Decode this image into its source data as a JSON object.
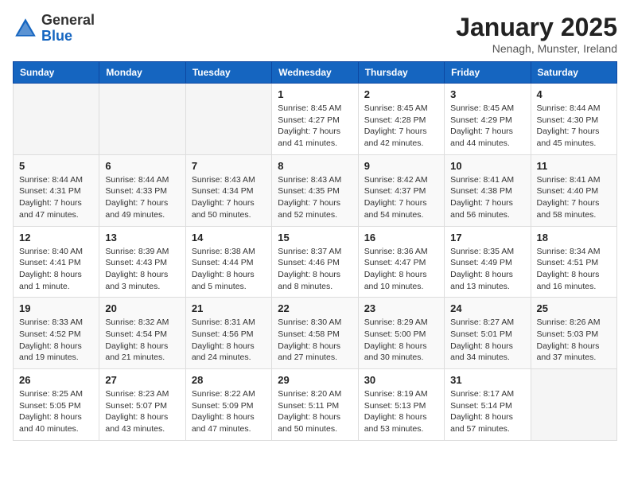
{
  "logo": {
    "general": "General",
    "blue": "Blue"
  },
  "header": {
    "title": "January 2025",
    "location": "Nenagh, Munster, Ireland"
  },
  "weekdays": [
    "Sunday",
    "Monday",
    "Tuesday",
    "Wednesday",
    "Thursday",
    "Friday",
    "Saturday"
  ],
  "weeks": [
    [
      {
        "day": "",
        "text": ""
      },
      {
        "day": "",
        "text": ""
      },
      {
        "day": "",
        "text": ""
      },
      {
        "day": "1",
        "text": "Sunrise: 8:45 AM\nSunset: 4:27 PM\nDaylight: 7 hours\nand 41 minutes."
      },
      {
        "day": "2",
        "text": "Sunrise: 8:45 AM\nSunset: 4:28 PM\nDaylight: 7 hours\nand 42 minutes."
      },
      {
        "day": "3",
        "text": "Sunrise: 8:45 AM\nSunset: 4:29 PM\nDaylight: 7 hours\nand 44 minutes."
      },
      {
        "day": "4",
        "text": "Sunrise: 8:44 AM\nSunset: 4:30 PM\nDaylight: 7 hours\nand 45 minutes."
      }
    ],
    [
      {
        "day": "5",
        "text": "Sunrise: 8:44 AM\nSunset: 4:31 PM\nDaylight: 7 hours\nand 47 minutes."
      },
      {
        "day": "6",
        "text": "Sunrise: 8:44 AM\nSunset: 4:33 PM\nDaylight: 7 hours\nand 49 minutes."
      },
      {
        "day": "7",
        "text": "Sunrise: 8:43 AM\nSunset: 4:34 PM\nDaylight: 7 hours\nand 50 minutes."
      },
      {
        "day": "8",
        "text": "Sunrise: 8:43 AM\nSunset: 4:35 PM\nDaylight: 7 hours\nand 52 minutes."
      },
      {
        "day": "9",
        "text": "Sunrise: 8:42 AM\nSunset: 4:37 PM\nDaylight: 7 hours\nand 54 minutes."
      },
      {
        "day": "10",
        "text": "Sunrise: 8:41 AM\nSunset: 4:38 PM\nDaylight: 7 hours\nand 56 minutes."
      },
      {
        "day": "11",
        "text": "Sunrise: 8:41 AM\nSunset: 4:40 PM\nDaylight: 7 hours\nand 58 minutes."
      }
    ],
    [
      {
        "day": "12",
        "text": "Sunrise: 8:40 AM\nSunset: 4:41 PM\nDaylight: 8 hours\nand 1 minute."
      },
      {
        "day": "13",
        "text": "Sunrise: 8:39 AM\nSunset: 4:43 PM\nDaylight: 8 hours\nand 3 minutes."
      },
      {
        "day": "14",
        "text": "Sunrise: 8:38 AM\nSunset: 4:44 PM\nDaylight: 8 hours\nand 5 minutes."
      },
      {
        "day": "15",
        "text": "Sunrise: 8:37 AM\nSunset: 4:46 PM\nDaylight: 8 hours\nand 8 minutes."
      },
      {
        "day": "16",
        "text": "Sunrise: 8:36 AM\nSunset: 4:47 PM\nDaylight: 8 hours\nand 10 minutes."
      },
      {
        "day": "17",
        "text": "Sunrise: 8:35 AM\nSunset: 4:49 PM\nDaylight: 8 hours\nand 13 minutes."
      },
      {
        "day": "18",
        "text": "Sunrise: 8:34 AM\nSunset: 4:51 PM\nDaylight: 8 hours\nand 16 minutes."
      }
    ],
    [
      {
        "day": "19",
        "text": "Sunrise: 8:33 AM\nSunset: 4:52 PM\nDaylight: 8 hours\nand 19 minutes."
      },
      {
        "day": "20",
        "text": "Sunrise: 8:32 AM\nSunset: 4:54 PM\nDaylight: 8 hours\nand 21 minutes."
      },
      {
        "day": "21",
        "text": "Sunrise: 8:31 AM\nSunset: 4:56 PM\nDaylight: 8 hours\nand 24 minutes."
      },
      {
        "day": "22",
        "text": "Sunrise: 8:30 AM\nSunset: 4:58 PM\nDaylight: 8 hours\nand 27 minutes."
      },
      {
        "day": "23",
        "text": "Sunrise: 8:29 AM\nSunset: 5:00 PM\nDaylight: 8 hours\nand 30 minutes."
      },
      {
        "day": "24",
        "text": "Sunrise: 8:27 AM\nSunset: 5:01 PM\nDaylight: 8 hours\nand 34 minutes."
      },
      {
        "day": "25",
        "text": "Sunrise: 8:26 AM\nSunset: 5:03 PM\nDaylight: 8 hours\nand 37 minutes."
      }
    ],
    [
      {
        "day": "26",
        "text": "Sunrise: 8:25 AM\nSunset: 5:05 PM\nDaylight: 8 hours\nand 40 minutes."
      },
      {
        "day": "27",
        "text": "Sunrise: 8:23 AM\nSunset: 5:07 PM\nDaylight: 8 hours\nand 43 minutes."
      },
      {
        "day": "28",
        "text": "Sunrise: 8:22 AM\nSunset: 5:09 PM\nDaylight: 8 hours\nand 47 minutes."
      },
      {
        "day": "29",
        "text": "Sunrise: 8:20 AM\nSunset: 5:11 PM\nDaylight: 8 hours\nand 50 minutes."
      },
      {
        "day": "30",
        "text": "Sunrise: 8:19 AM\nSunset: 5:13 PM\nDaylight: 8 hours\nand 53 minutes."
      },
      {
        "day": "31",
        "text": "Sunrise: 8:17 AM\nSunset: 5:14 PM\nDaylight: 8 hours\nand 57 minutes."
      },
      {
        "day": "",
        "text": ""
      }
    ]
  ]
}
